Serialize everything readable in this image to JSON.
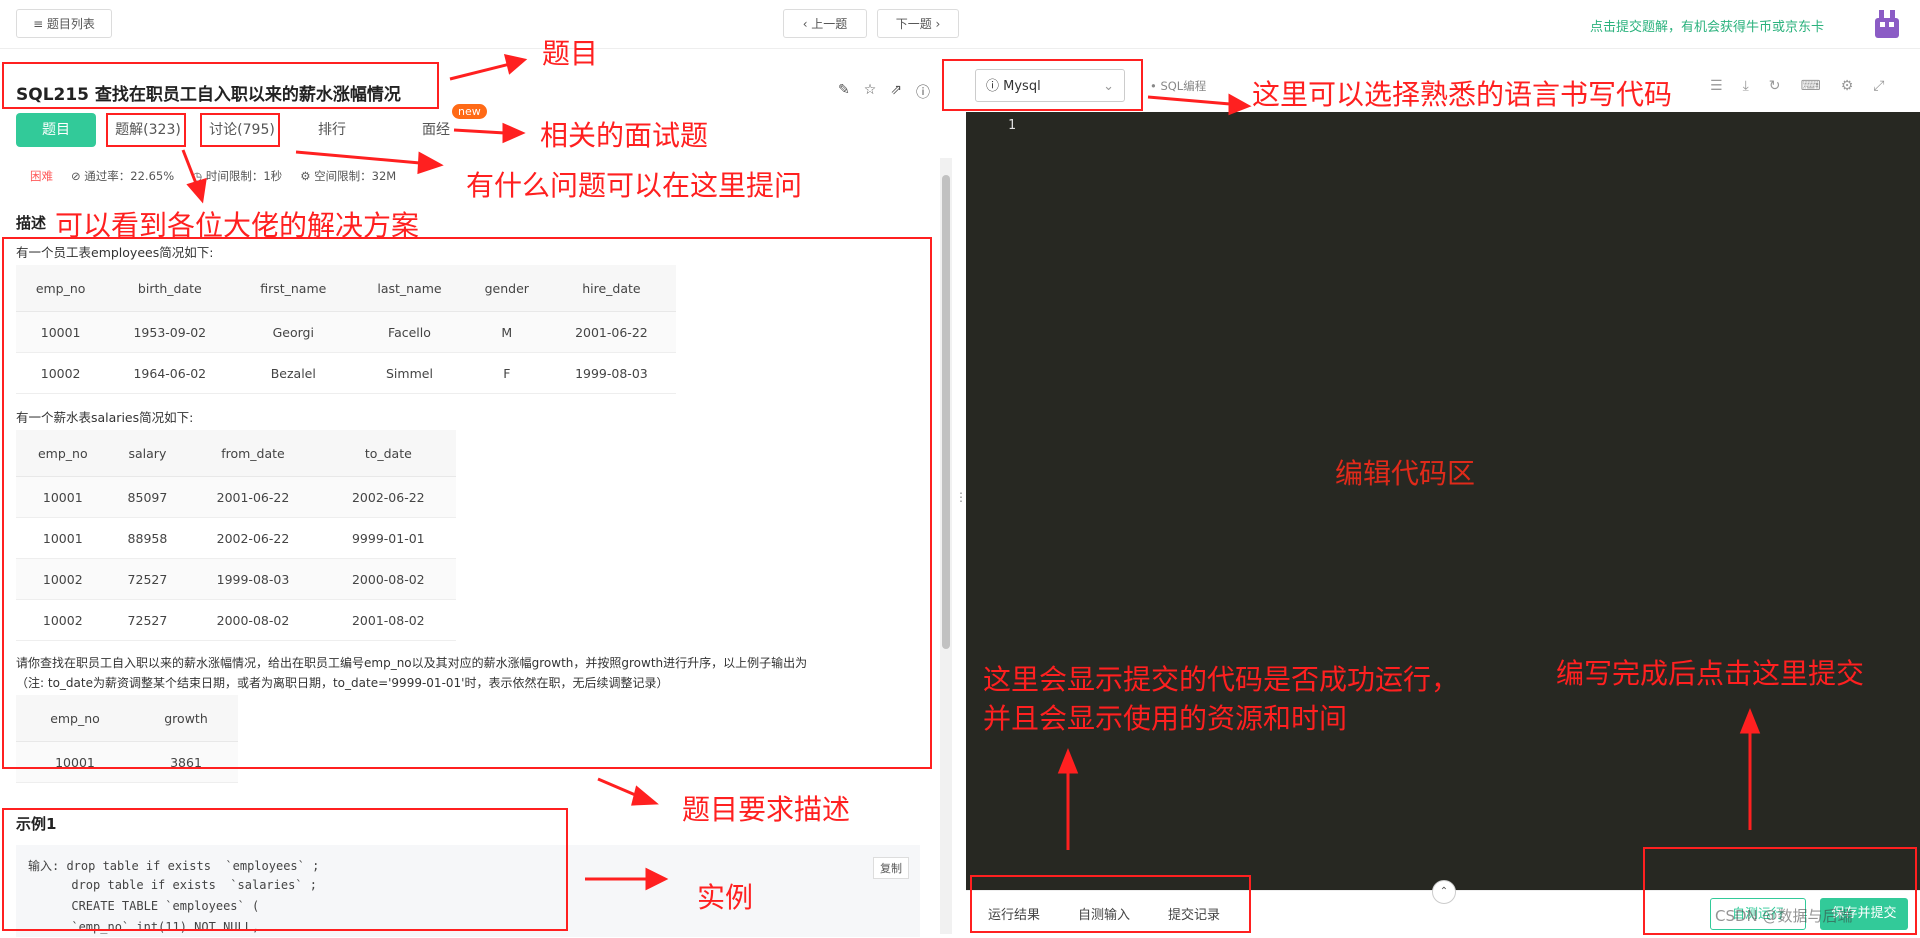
{
  "topbar": {
    "list_label": "≡ 题目列表",
    "prev_label": "‹ 上一题",
    "next_label": "下一题 ›",
    "promo": "点击提交题解，有机会获得牛币或京东卡"
  },
  "problem": {
    "title": "SQL215  查找在职员工自入职以来的薪水涨幅情况",
    "tabs": [
      "题目",
      "题解(323)",
      "讨论(795)",
      "排行",
      "面经"
    ],
    "new_badge": "new",
    "difficulty": "困难",
    "pass_rate": "通过率：22.65%",
    "time_limit": "时间限制：1秒",
    "space_limit": "空间限制：32M",
    "desc_heading": "描述",
    "desc_intro_1": "有一个员工表employees简况如下:",
    "employees": {
      "headers": [
        "emp_no",
        "birth_date",
        "first_name",
        "last_name",
        "gender",
        "hire_date"
      ],
      "rows": [
        [
          "10001",
          "1953-09-02",
          "Georgi",
          "Facello",
          "M",
          "2001-06-22"
        ],
        [
          "10002",
          "1964-06-02",
          "Bezalel",
          "Simmel",
          "F",
          "1999-08-03"
        ]
      ]
    },
    "desc_intro_2": "有一个薪水表salaries简况如下:",
    "salaries": {
      "headers": [
        "emp_no",
        "salary",
        "from_date",
        "to_date"
      ],
      "rows": [
        [
          "10001",
          "85097",
          "2001-06-22",
          "2002-06-22"
        ],
        [
          "10001",
          "88958",
          "2002-06-22",
          "9999-01-01"
        ],
        [
          "10002",
          "72527",
          "1999-08-03",
          "2000-08-02"
        ],
        [
          "10002",
          "72527",
          "2000-08-02",
          "2001-08-02"
        ]
      ]
    },
    "request_line_1": "请你查找在职员工自入职以来的薪水涨幅情况，给出在职员工编号emp_no以及其对应的薪水涨幅growth，并按照growth进行升序，以上例子输出为",
    "request_line_2": "（注: to_date为薪资调整某个结束日期，或者为离职日期，to_date='9999-01-01'时，表示依然在职，无后续调整记录）",
    "result": {
      "headers": [
        "emp_no",
        "growth"
      ],
      "rows": [
        [
          "10001",
          "3861"
        ]
      ]
    },
    "example_heading": "示例1",
    "example_lines": [
      "输入: drop table if exists  `employees` ;",
      "      drop table if exists  `salaries` ;",
      "      CREATE TABLE `employees` (",
      "      `emp_no` int(11) NOT NULL,"
    ],
    "copy_label": "复制"
  },
  "editor": {
    "language": "Mysql",
    "mode_label": "• SQL编程",
    "line_number": "1",
    "bottom_tabs": [
      "运行结果",
      "自测输入",
      "提交记录"
    ],
    "run_label": "自测运行",
    "submit_label": "保存并提交",
    "watermark": "CSDN @数据与后端"
  },
  "annotations": {
    "title": "题目",
    "language": "这里可以选择熟悉的语言书写代码",
    "interview": "相关的面试题",
    "discuss": "有什么问题可以在这里提问",
    "solutions": "可以看到各位大佬的解决方案",
    "editor_area": "编辑代码区",
    "result_line_1": "这里会显示提交的代码是否成功运行，",
    "result_line_2": "并且会显示使用的资源和时间",
    "submit": "编写完成后点击这里提交",
    "description": "题目要求描述",
    "example": "实例"
  }
}
